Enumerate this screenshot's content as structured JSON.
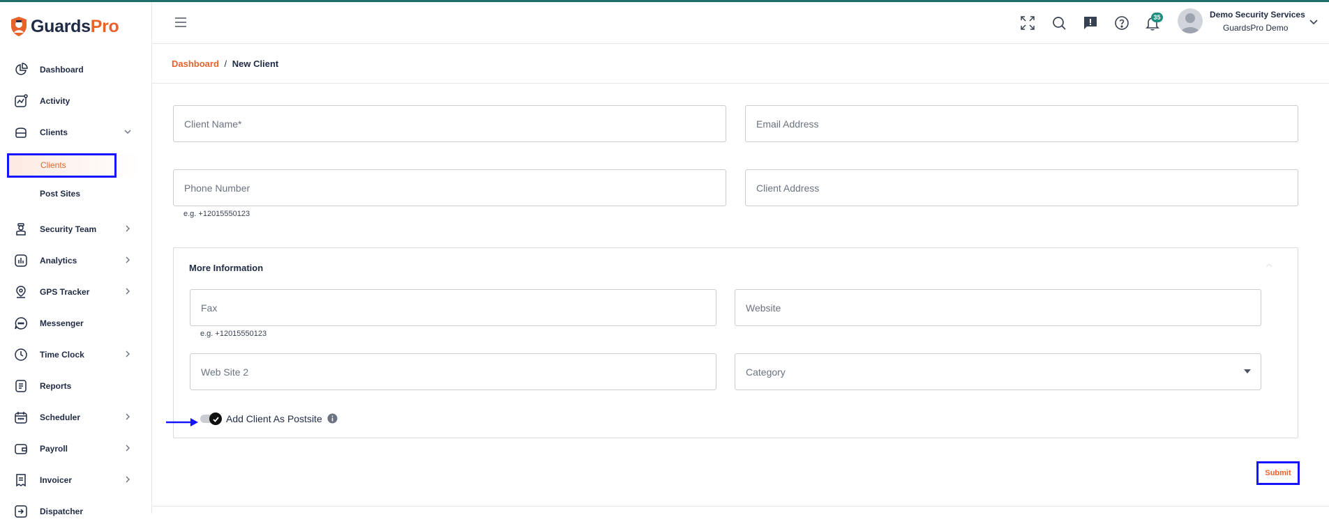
{
  "app": {
    "logo_part1": "Guards",
    "logo_part2": "Pro"
  },
  "sidebar": {
    "items": [
      {
        "label": "Dashboard",
        "icon": "pie-chart-icon"
      },
      {
        "label": "Activity",
        "icon": "activity-icon"
      },
      {
        "label": "Clients",
        "icon": "briefcase-icon",
        "expanded": true
      },
      {
        "label": "Security Team",
        "icon": "guard-icon"
      },
      {
        "label": "Analytics",
        "icon": "analytics-icon"
      },
      {
        "label": "GPS Tracker",
        "icon": "location-pin-icon"
      },
      {
        "label": "Messenger",
        "icon": "chat-icon"
      },
      {
        "label": "Time Clock",
        "icon": "clock-icon"
      },
      {
        "label": "Reports",
        "icon": "reports-icon"
      },
      {
        "label": "Scheduler",
        "icon": "calendar-icon"
      },
      {
        "label": "Payroll",
        "icon": "wallet-icon"
      },
      {
        "label": "Invoicer",
        "icon": "invoice-icon"
      },
      {
        "label": "Dispatcher",
        "icon": "dispatch-icon"
      }
    ],
    "sub_items": [
      {
        "label": "Clients",
        "active": true
      },
      {
        "label": "Post Sites",
        "active": false
      }
    ]
  },
  "header": {
    "notification_count": "35",
    "user_name": "Demo Security Services",
    "user_org": "GuardsPro Demo"
  },
  "breadcrumb": {
    "home": "Dashboard",
    "separator": "/",
    "current": "New Client"
  },
  "form": {
    "client_name_placeholder": "Client Name*",
    "email_placeholder": "Email Address",
    "phone_placeholder": "Phone Number",
    "phone_hint": "e.g. +12015550123",
    "address_placeholder": "Client Address",
    "more_info_title": "More Information",
    "fax_placeholder": "Fax",
    "fax_hint": "e.g. +12015550123",
    "website_placeholder": "Website",
    "website2_placeholder": "Web Site 2",
    "category_placeholder": "Category",
    "postsite_toggle_label": "Add Client As Postsite",
    "postsite_toggle_on": true,
    "submit_label": "Submit"
  },
  "colors": {
    "accent": "#e8622c",
    "navy": "#1f2a44",
    "highlight": "#1414ff",
    "badge": "#1e8f7f"
  }
}
